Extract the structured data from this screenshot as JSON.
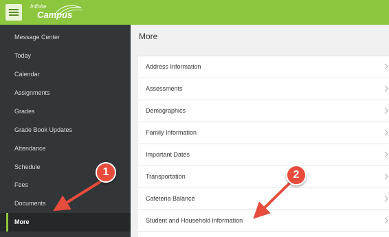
{
  "header": {
    "logo_line1": "Infinite",
    "logo_line2": "Campus",
    "colors": {
      "bar": "#8cc63f",
      "sidebar": "#333638"
    }
  },
  "sidebar": {
    "items": [
      {
        "label": "Message Center"
      },
      {
        "label": "Today"
      },
      {
        "label": "Calendar"
      },
      {
        "label": "Assignments"
      },
      {
        "label": "Grades"
      },
      {
        "label": "Grade Book Updates"
      },
      {
        "label": "Attendance"
      },
      {
        "label": "Schedule"
      },
      {
        "label": "Fees"
      },
      {
        "label": "Documents"
      },
      {
        "label": "More",
        "active": true
      }
    ]
  },
  "main": {
    "title": "More",
    "items": [
      {
        "label": "Address Information",
        "icon": "chevron-right-icon"
      },
      {
        "label": "Assessments",
        "icon": "chevron-right-icon"
      },
      {
        "label": "Demographics",
        "icon": "chevron-right-icon"
      },
      {
        "label": "Family Information",
        "icon": "chevron-right-icon"
      },
      {
        "label": "Important Dates",
        "icon": "chevron-right-icon"
      },
      {
        "label": "Transportation",
        "icon": "chevron-right-icon"
      },
      {
        "label": "Cafeteria Balance",
        "icon": "chevron-right-icon"
      },
      {
        "label": "Student and Household information",
        "icon": "chevron-right-icon"
      }
    ]
  },
  "annotations": [
    {
      "number": "1",
      "color": "#e74c3c"
    },
    {
      "number": "2",
      "color": "#e74c3c"
    }
  ]
}
